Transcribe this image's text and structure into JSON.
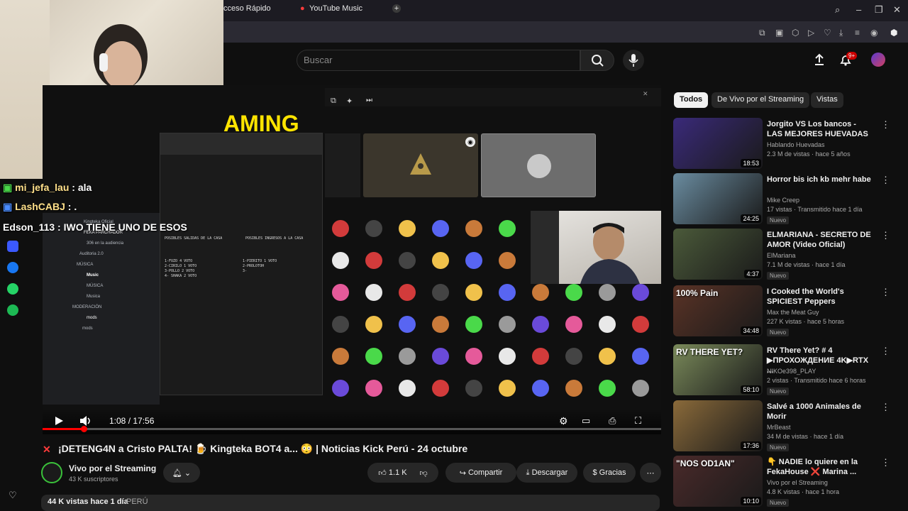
{
  "browser": {
    "tab1": "cceso Rápido",
    "tab2": "YouTube Music"
  },
  "search": {
    "placeholder": "Buscar"
  },
  "notif_count": "9+",
  "chat": [
    {
      "user": "mi_jefa_lau",
      "msg": " : ala"
    },
    {
      "user": "LashCABJ",
      "msg": " : ."
    },
    {
      "user": "Edson_113",
      "msg": " : IWO TIENE UNO DE ESOS"
    }
  ],
  "stream": {
    "banner": "AMING",
    "notepad_h1": "POSIBLES SALIDAS DE LA CASA",
    "notepad_h2": "POSIBLES INGRESOS A LA CASA",
    "notepad_left": [
      "1-FUZO 4 VOTO",
      "2-CIRILO 1 VOTO",
      "3-POLLO 2 VOTO",
      "4- SHAKA 2 VOTO"
    ],
    "notepad_right": [
      "1-PIERITO 1 VOTO",
      "2-PROLOTOH",
      "3-"
    ],
    "discord_items": [
      "Kingteka Oficial",
      "FEKA PARCHADOR",
      "306 en la audiencia",
      "Auditoria 2.0",
      "MÚSICA",
      "Music",
      "MÚSICA",
      "Musica",
      "MODERACIÓN",
      "mods",
      "mods"
    ]
  },
  "player": {
    "time": "1:08 / 17:56",
    "progress": 0.063
  },
  "video": {
    "title": "¡DETENG4N a Cristo PALTA! 🍺 Kingteka BOT4 a... 😳 | Noticias Kick Perú - 24 octubre",
    "channel": "Vivo por el Streaming",
    "subs": "43 K suscriptores",
    "likes": "1.1 K",
    "share": "Compartir",
    "download": "Descargar",
    "thanks": "Gracias",
    "views": "44 K vistas  hace 1 día",
    "country": "PERÚ"
  },
  "chips": [
    "Todos",
    "De Vivo por el Streaming",
    "Vistas"
  ],
  "recs": [
    {
      "title": "Jorgito VS Los bancos - LAS MEJORES HUEVADAS",
      "channel": "Hablando Huevadas",
      "meta": "2.3 M de vistas · hace 5 años",
      "dur": "18:53",
      "badge": "",
      "color": "#3a2a7a"
    },
    {
      "title": "Horror bis ich kb mehr habe",
      "channel": "Mike Creep",
      "meta": "17 vistas · Transmitido hace 1 día",
      "dur": "24:25",
      "badge": "Nuevo",
      "color": "#6a8ca0"
    },
    {
      "title": "ELMARIANA - SECRETO DE AMOR (Video Oficial)",
      "channel": "ElMariana",
      "meta": "7.1 M de vistas · hace 1 día",
      "dur": "4:37",
      "badge": "Nuevo",
      "color": "#4b5a3a"
    },
    {
      "title": "I Cooked the World's SPICIEST Peppers",
      "channel": "Max the Meat Guy",
      "meta": "227 K vistas · hace 5 horas",
      "dur": "34:48",
      "badge": "Nuevo",
      "thumbtext": "100% Pain",
      "color": "#5a3326"
    },
    {
      "title": "RV There Yet? # 4 ▶ПРОХОЖДЕНИЕ 4K▶RTX ...",
      "channel": "NIKOe398_PLAY",
      "meta": "2 vistas · Transmitido hace 6 horas",
      "dur": "58:10",
      "badge": "Nuevo",
      "thumbtext": "RV THERE YET?",
      "color": "#7a8a5a"
    },
    {
      "title": "Salvé a 1000 Animales de Morir",
      "channel": "MrBeast",
      "meta": "34 M de vistas · hace 1 día",
      "dur": "17:36",
      "badge": "Nuevo",
      "color": "#8a6a3a"
    },
    {
      "title": "👇 NADIE lo quiere en la FekaHouse ❌ Marina ...",
      "channel": "Vivo por el Streaming",
      "meta": "4.8 K vistas · hace 1 hora",
      "dur": "10:10",
      "badge": "Nuevo",
      "thumbtext": "\"NOS OD1AN\"",
      "color": "#4a2a2a"
    }
  ],
  "colors": {
    "accent": "#ff0000",
    "chip_active": "#f1f1f1",
    "green": "#3ac13a"
  }
}
